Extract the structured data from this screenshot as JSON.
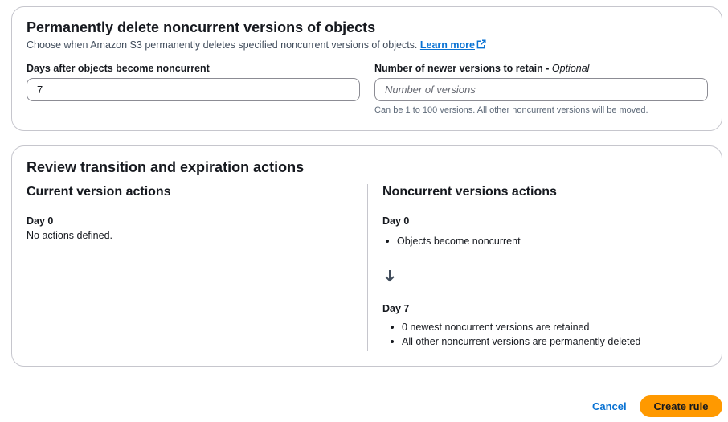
{
  "delete_section": {
    "title": "Permanently delete noncurrent versions of objects",
    "description": "Choose when Amazon S3 permanently deletes specified noncurrent versions of objects.",
    "learn_more": "Learn more",
    "learn_more_icon": "external-link-icon",
    "days_field": {
      "label": "Days after objects become noncurrent",
      "value": "7"
    },
    "versions_field": {
      "label": "Number of newer versions to retain",
      "optional_suffix": "Optional",
      "separator": " - ",
      "placeholder": "Number of versions",
      "value": "",
      "hint": "Can be 1 to 100 versions. All other noncurrent versions will be moved."
    }
  },
  "review_section": {
    "title": "Review transition and expiration actions",
    "current": {
      "title": "Current version actions",
      "day_label": "Day 0",
      "text": "No actions defined."
    },
    "noncurrent": {
      "title": "Noncurrent versions actions",
      "first_day_label": "Day 0",
      "first_items": [
        "Objects become noncurrent"
      ],
      "arrow_icon": "arrow-down-icon",
      "second_day_label": "Day 7",
      "second_items": [
        "0 newest noncurrent versions are retained",
        "All other noncurrent versions are permanently deleted"
      ]
    }
  },
  "footer": {
    "cancel_label": "Cancel",
    "create_label": "Create rule"
  },
  "colors": {
    "primary_button": "#ff9900",
    "link": "#0972d3",
    "border": "#c6c6cd",
    "text": "#16191f"
  }
}
